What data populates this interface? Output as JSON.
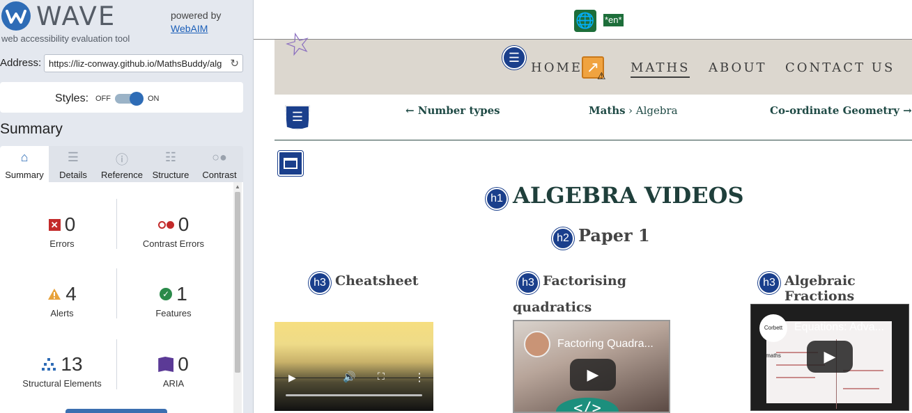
{
  "wave": {
    "logo_text": "WAVE",
    "logo_subtitle": "web accessibility evaluation tool",
    "powered_by": "powered by",
    "powered_link": "WebAIM",
    "address_label": "Address:",
    "address_value": "https://liz-conway.github.io/MathsBuddy/alg",
    "styles_label": "Styles:",
    "styles_off": "OFF",
    "styles_on": "ON",
    "styles_enabled": true,
    "summary_heading": "Summary",
    "tabs": [
      {
        "label": "Summary",
        "icon": "home-icon",
        "active": true
      },
      {
        "label": "Details",
        "icon": "list-icon",
        "active": false
      },
      {
        "label": "Reference",
        "icon": "info-icon",
        "active": false
      },
      {
        "label": "Structure",
        "icon": "structure-icon",
        "active": false
      },
      {
        "label": "Contrast",
        "icon": "contrast-icon",
        "active": false
      }
    ],
    "stats": {
      "errors": {
        "count": "0",
        "label": "Errors"
      },
      "contrast_errors": {
        "count": "0",
        "label": "Contrast Errors"
      },
      "alerts": {
        "count": "4",
        "label": "Alerts"
      },
      "features": {
        "count": "1",
        "label": "Features"
      },
      "structural": {
        "count": "13",
        "label": "Structural Elements"
      },
      "aria": {
        "count": "0",
        "label": "ARIA"
      }
    },
    "colors": {
      "accent": "#2e6cb6",
      "error": "#c32b2b",
      "alert": "#e8a23a",
      "feature": "#2a8a4a",
      "aria": "#5b3a96"
    }
  },
  "page": {
    "lang_badge": "*en*",
    "nav": {
      "home": "HOME",
      "maths": "MATHS",
      "about": "ABOUT",
      "contact": "CONTACT US"
    },
    "breadcrumb": {
      "prev": "← Number types",
      "section": "Maths",
      "current": "› Algebra",
      "next": "Co-ordinate Geometry →"
    },
    "badges": {
      "h1": "h1",
      "h2": "h2",
      "h3": "h3"
    },
    "h1": "ALGEBRA VIDEOS",
    "h2": "Paper 1",
    "h3": [
      "Cheatsheet",
      "Factorising",
      "quadratics",
      "Algebraic Fractions"
    ],
    "videos": [
      {
        "title": ""
      },
      {
        "title": "Factoring Quadra..."
      },
      {
        "title": "Equations: Adva...",
        "channel": "Corbett maths"
      }
    ],
    "colors": {
      "heading": "#1f3f3b",
      "nav_band": "#dcd7cf",
      "wave_badge": "#1a3f8c"
    }
  }
}
